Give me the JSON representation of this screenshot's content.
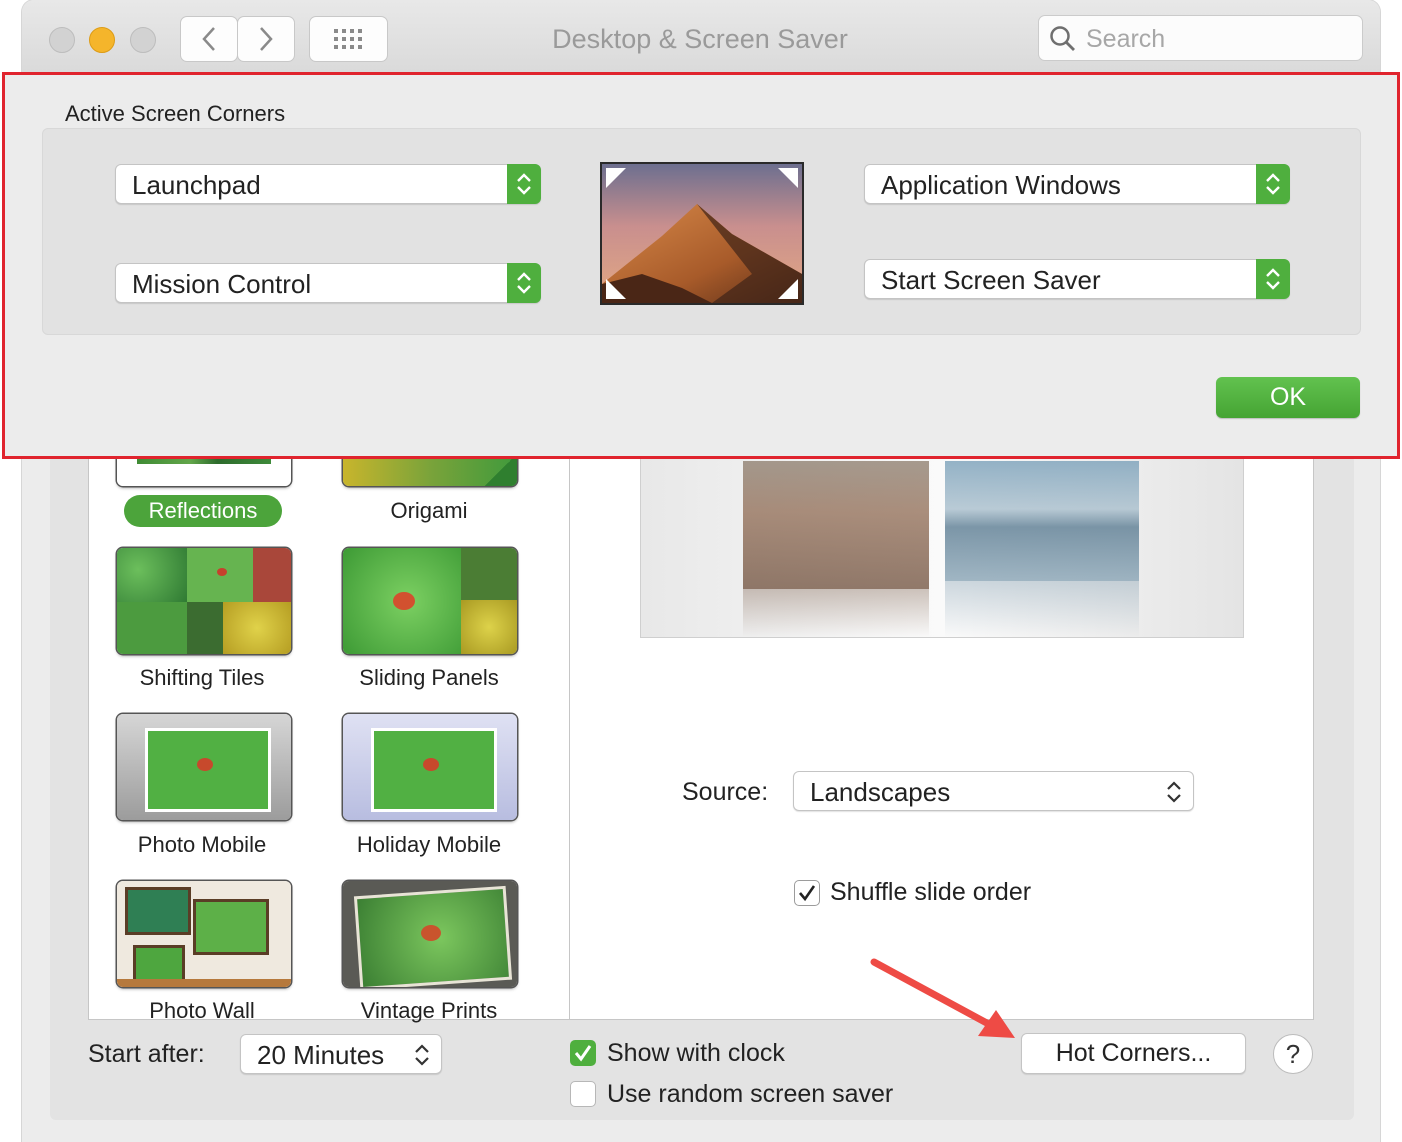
{
  "window": {
    "title": "Desktop & Screen Saver",
    "search_placeholder": "Search"
  },
  "sheet": {
    "title": "Active Screen Corners",
    "corners": {
      "top_left": "Launchpad",
      "bottom_left": "Mission Control",
      "top_right": "Application Windows",
      "bottom_right": "Start Screen Saver"
    },
    "ok_label": "OK"
  },
  "savers": [
    {
      "name": "Reflections",
      "selected": true
    },
    {
      "name": "Origami",
      "selected": false
    },
    {
      "name": "Shifting Tiles",
      "selected": false
    },
    {
      "name": "Sliding Panels",
      "selected": false
    },
    {
      "name": "Photo Mobile",
      "selected": false
    },
    {
      "name": "Holiday Mobile",
      "selected": false
    },
    {
      "name": "Photo Wall",
      "selected": false
    },
    {
      "name": "Vintage Prints",
      "selected": false
    }
  ],
  "options": {
    "source_label": "Source:",
    "source_value": "Landscapes",
    "shuffle_label": "Shuffle slide order",
    "shuffle_checked": true
  },
  "footer": {
    "start_after_label": "Start after:",
    "start_after_value": "20 Minutes",
    "show_clock_label": "Show with clock",
    "show_clock_checked": true,
    "random_label": "Use random screen saver",
    "random_checked": false,
    "hot_corners_label": "Hot Corners...",
    "help_label": "?"
  },
  "colors": {
    "accent_green": "#4faf3e",
    "highlight_red": "#e0242e",
    "annotation_arrow": "#ee4b45"
  }
}
